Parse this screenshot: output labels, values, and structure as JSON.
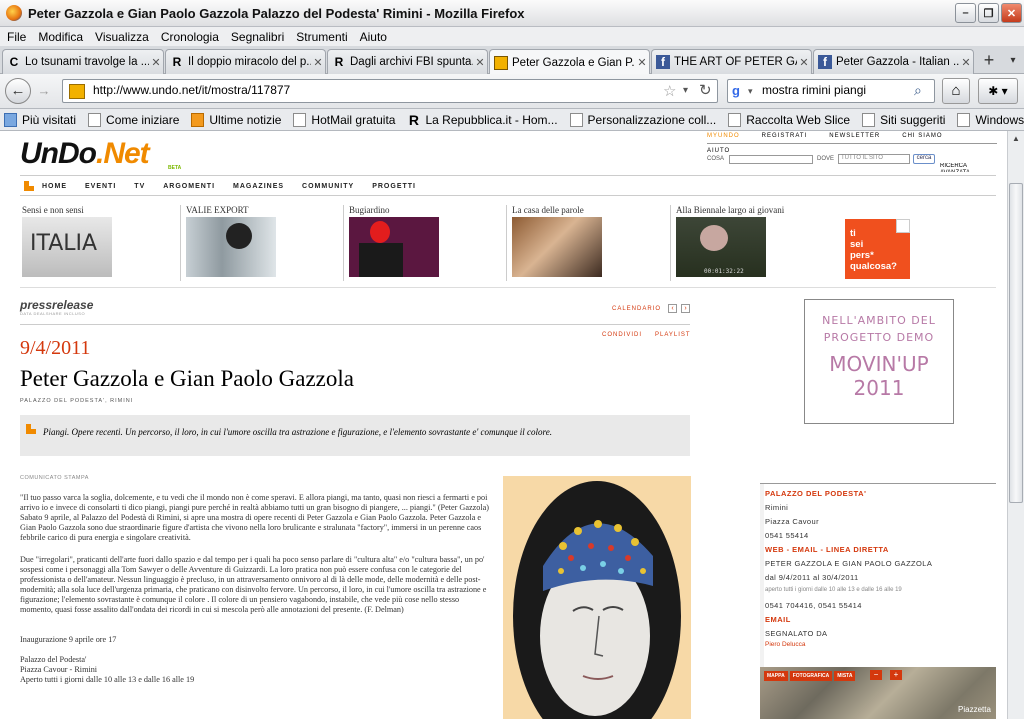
{
  "window": {
    "title": "Peter Gazzola e Gian Paolo Gazzola Palazzo del Podesta' Rimini - Mozilla Firefox"
  },
  "menu": [
    "File",
    "Modifica",
    "Visualizza",
    "Cronologia",
    "Segnalibri",
    "Strumenti",
    "Aiuto"
  ],
  "tabs": [
    {
      "label": "Lo tsunami travolge la ...",
      "icon": "C"
    },
    {
      "label": "Il doppio miracolo del p...",
      "icon": "R"
    },
    {
      "label": "Dagli archivi FBI spunta...",
      "icon": "R"
    },
    {
      "label": "Peter Gazzola e Gian P...",
      "icon": "undo"
    },
    {
      "label": "THE ART OF PETER GA...",
      "icon": "f"
    },
    {
      "label": "Peter Gazzola - Italian ...",
      "icon": "f"
    }
  ],
  "nav": {
    "url": "http://www.undo.net/it/mostra/117877",
    "search": "mostra rimini piangi"
  },
  "bookmarks": [
    "Più visitati",
    "Come iniziare",
    "Ultime notizie",
    "HotMail gratuita",
    "La Repubblica.it - Hom...",
    "Personalizzazione coll...",
    "Raccolta Web Slice",
    "Siti suggeriti",
    "WindowsMedia"
  ],
  "site": {
    "logo_a": "UnDo",
    "logo_b": ".Net",
    "logo_beta": "BETA",
    "top_links": [
      "MYUNDO",
      "REGISTRATI",
      "NEWSLETTER",
      "CHI SIAMO"
    ],
    "aiuto": "AIUTO",
    "cosa": "COSA",
    "dove": "DOVE",
    "dove_value": "TUTTO IL SITO",
    "cerca": "cerca",
    "ricerca": "RICERCA AVANZATA",
    "nav": [
      "HOME",
      "EVENTI",
      "TV",
      "ARGOMENTI",
      "MAGAZINES",
      "COMMUNITY",
      "PROGETTI"
    ],
    "features": [
      "Sensi e non sensi",
      "VALIE EXPORT",
      "Bugiardino",
      "La casa delle parole",
      "Alla Biennale largo ai giovani"
    ],
    "video_time": "00:01:32:22",
    "promo": [
      "ti",
      "sei",
      "pers*",
      "qualcosa?"
    ],
    "thumb_text": "ITALIA"
  },
  "article": {
    "press": "pressrelease",
    "press_tag": "DATA DEALSHARE INCLUSO",
    "calendario": "CALENDARIO",
    "condividi": "CONDIVIDI",
    "playlist": "PLAYLIST",
    "date": "9/4/2011",
    "title": "Peter Gazzola e Gian Paolo Gazzola",
    "venue": "PALAZZO DEL PODESTA', RIMINI",
    "summary": "Piangi. Opere recenti. Un percorso, il loro, in cui l'umore oscilla tra astrazione e figurazione, e l'elemento sovrastante e' comunque il colore.",
    "comunicato": "COMUNICATO STAMPA",
    "p1": "\"Il tuo passo varca la soglia, dolcemente, e tu vedi che il mondo non è come speravi. E allora piangi, ma tanto, quasi non riesci a fermarti e poi arrivo io e invece di consolarti ti dico piangi, piangi pure perché in realtà abbiamo tutti un gran bisogno di piangere, ... piangi.\" (Peter Gazzola) Sabato 9 aprile, al Palazzo del Podestà di Rimini, si apre una mostra di opere recenti di Peter Gazzola e Gian Paolo Gazzola. Peter Gazzola e Gian Paolo Gazzola sono due straordinarie figure d'artista che vivono nella loro brulicante e stralunata \"factory\", immersi in un perenne caos febbrile carico di pura energia e singolare creatività.",
    "p2": "Due \"irregolari\", praticanti dell'arte fuori dallo spazio e dal tempo per i quali ha poco senso parlare di \"cultura alta\" e/o \"cultura bassa\", un po' sospesi come i personaggi alla Tom Sawyer o delle Avventure di Guizzardi. La loro pratica non può essere confusa con le categorie del professionista o dell'amateur. Nessun linguaggio è precluso, in un attraversamento onnivoro al di là delle mode, delle modernità e delle post-modernità; alla sola luce dell'urgenza primaria, che praticano con disinvolto fervore. Un percorso, il loro, in cui l'umore oscilla tra astrazione e figurazione; l'elemento sovrastante è comunque il colore . Il colore di un pensiero vagabondo, instabile, che vede più cose nello stesso momento, quasi fosse assalito dall'ondata dei ricordi in cui si mescola però alle annotazioni del presente. (F. Delman)",
    "p3": "Inaugurazione 9 aprile ore 17",
    "p4a": "Palazzo del Podesta'",
    "p4b": "Piazza Cavour - Rimini",
    "p4c": "Aperto tutti i giorni dalle 10 alle 13 e dalle 16 alle 19"
  },
  "ad": {
    "line1": "NELL'AMBITO DEL",
    "line2": "PROGETTO DEMO",
    "line3": "MOVIN'UP",
    "line4": "2011"
  },
  "info": {
    "venue": "PALAZZO DEL PODESTA'",
    "city": "Rimini",
    "address": "Piazza Cavour",
    "phone": "0541 55414",
    "web_label": "WEB - EMAIL - LINEA DIRETTA",
    "artists": "PETER GAZZOLA E GIAN PAOLO GAZZOLA",
    "dates": "dal 9/4/2011 al 30/4/2011",
    "hours": "aperto tutti i giorni dalle 10 alle 13 e dalle 16 alle 19",
    "phones": "0541 704416, 0541 55414",
    "email_label": "EMAIL",
    "segnalato": "SEGNALATO DA",
    "segnalato_name": "Piero Delucca"
  },
  "map": {
    "buttons": [
      "MAPPA",
      "FOTOGRAFICA",
      "MISTA"
    ],
    "place": "Piazzetta"
  }
}
